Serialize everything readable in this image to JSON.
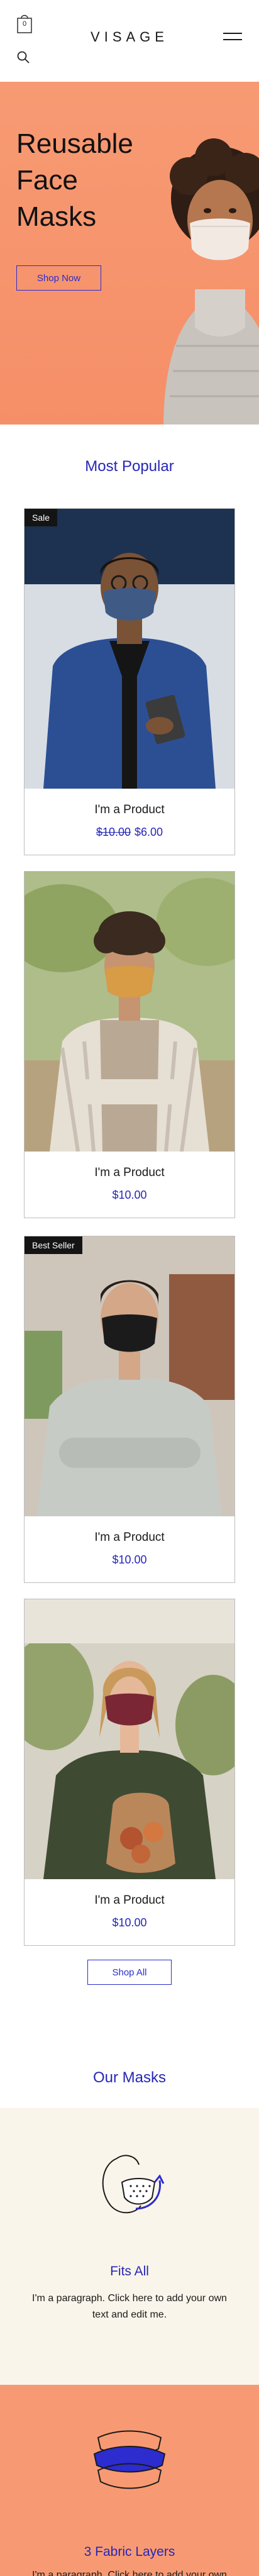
{
  "header": {
    "brand": "VISAGE",
    "cart_count": "0",
    "icons": [
      "cart-icon",
      "search-icon",
      "hamburger-menu-icon"
    ]
  },
  "hero": {
    "title_line1": "Reusable",
    "title_line2": "Face",
    "title_line3": "Masks",
    "button_label": "Shop Now",
    "background_color": "#f79a73"
  },
  "popular": {
    "title": "Most Popular",
    "products": [
      {
        "tag": "Sale",
        "name": "I'm a Product",
        "old_price": "$10.00",
        "price": "$6.00"
      },
      {
        "tag": "",
        "name": "I'm a Product",
        "old_price": "",
        "price": "$10.00"
      },
      {
        "tag": "Best Seller",
        "name": "I'm a Product",
        "old_price": "",
        "price": "$10.00"
      },
      {
        "tag": "",
        "name": "I'm a Product",
        "old_price": "",
        "price": "$10.00"
      }
    ],
    "shop_all_label": "Shop All"
  },
  "masks": {
    "title": "Our Masks",
    "features": [
      {
        "title": "Fits All",
        "text": "I'm a paragraph. Click here to add your own text and edit me."
      },
      {
        "title": "3 Fabric Layers",
        "text": "I'm a paragraph. Click here to add your own text and edit me."
      }
    ]
  },
  "colors": {
    "accent": "#2c2ccf",
    "peach": "#f79a73",
    "cream": "#faf5ea"
  }
}
